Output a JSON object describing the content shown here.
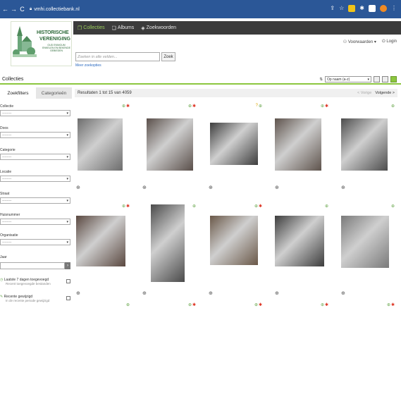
{
  "browser": {
    "url": "vmhi.collectiebank.nl"
  },
  "logo": {
    "line1": "HISTORISCHE",
    "line2": "VERENIGING",
    "tagline": "OUD ENNIGUM ENKELEN EN BEKENDE GEBIEDEN"
  },
  "topnav": {
    "items": [
      {
        "label": "Collecties",
        "icon": "folder-icon"
      },
      {
        "label": "Albums",
        "icon": "albums-icon"
      },
      {
        "label": "Zoekwoorden",
        "icon": "tag-icon"
      }
    ]
  },
  "user": {
    "favorites": "Voorwaarden",
    "login": "Login"
  },
  "search": {
    "placeholder": "Zoeken in alle velden...",
    "button": "Zoek",
    "more": "Meer zoekopties"
  },
  "page": {
    "title": "Collecties",
    "sort_value": "Op naam (a-z)"
  },
  "sidebar": {
    "tabs": [
      "Zoekfilters",
      "Categorieën"
    ],
    "filters": [
      {
        "label": "Collectie",
        "value": "--------"
      },
      {
        "label": "Doos",
        "value": "--------"
      },
      {
        "label": "Categorie",
        "value": "--------"
      },
      {
        "label": "Locatie",
        "value": "--------"
      },
      {
        "label": "Straat",
        "value": "--------"
      },
      {
        "label": "Huisnummer",
        "value": "--------"
      },
      {
        "label": "Organisatie",
        "value": "--------"
      }
    ],
    "jaar_label": "Jaar",
    "checks": [
      {
        "label": "Laatste 7 dagen toegevoegd",
        "sub": "Recent toegevoegde bestanden"
      },
      {
        "label": "Recente gewijzigd",
        "sub": "In de recente periode gewijzigd"
      }
    ]
  },
  "results": {
    "summary": "Resultaten 1 tot 15 van 4059",
    "prev": "< Vorige",
    "next": "Volgende >"
  },
  "grid": {
    "row1_icons": [
      [
        "ok",
        "pin"
      ],
      [
        "ok",
        "pin"
      ],
      [
        "q",
        "ok"
      ],
      [
        "ok",
        "pin"
      ],
      [
        "ok"
      ]
    ],
    "row2_icons": [
      [
        "ok",
        "pin"
      ],
      [
        "ok"
      ],
      [
        "ok",
        "pin"
      ],
      [
        "ok"
      ],
      [
        "ok"
      ]
    ],
    "row3_icons": [
      [
        "ok"
      ],
      [
        "ok",
        "pin"
      ],
      [
        "ok",
        "pin"
      ],
      [
        "ok",
        "pin"
      ],
      [
        "ok",
        "pin"
      ]
    ],
    "icon_glyphs": {
      "ok": "⊕",
      "pin": "✱",
      "q": "?"
    },
    "zoom_glyph": "⊕"
  },
  "colors": {
    "browser": "#2b5797",
    "accent": "#8cc63f",
    "nav": "#3b3b3b"
  }
}
